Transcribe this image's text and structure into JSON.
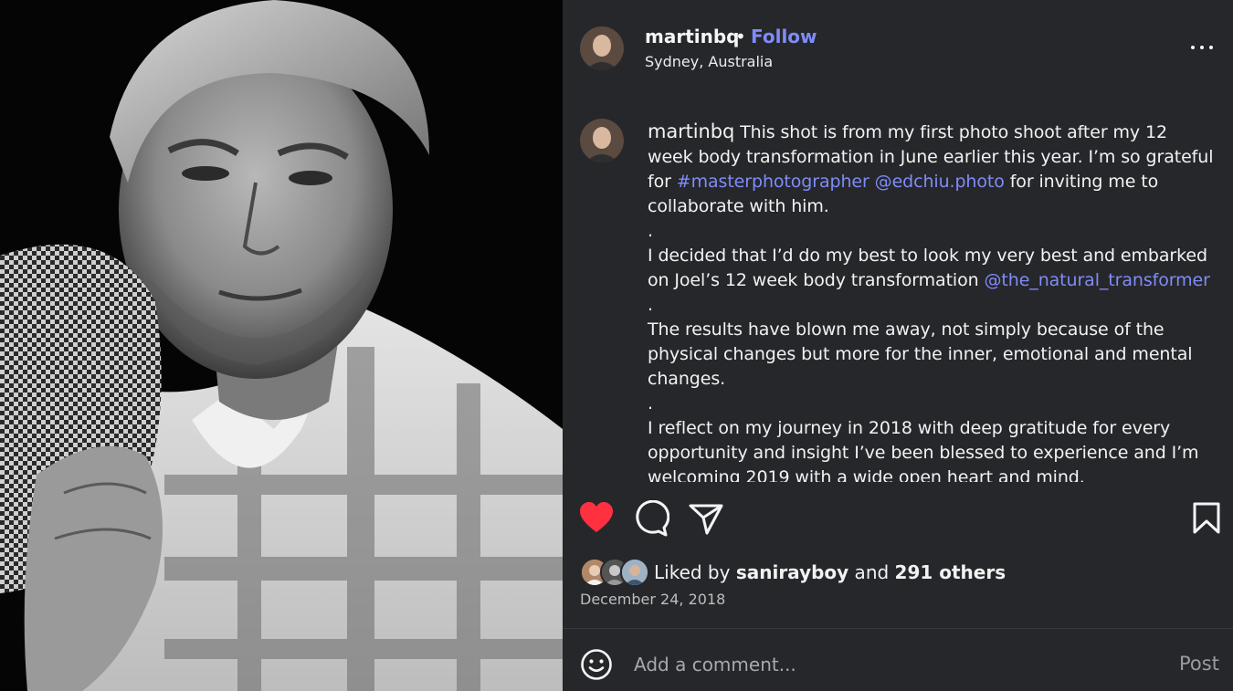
{
  "photo": {
    "icon": "portrait-photo",
    "description_icon": "black-and-white-man-portrait"
  },
  "header": {
    "username": "martinbq",
    "separator": "•",
    "follow_label": "Follow",
    "location": "Sydney, Australia",
    "more_icon": "more-horizontal-icon"
  },
  "caption": {
    "username": "martinbq",
    "p1_text1": " This shot is from my first photo shoot after my 12 week body transformation in June earlier this year. I’m so grateful for ",
    "p1_hashtag": "#masterphotographer",
    "p1_space": " ",
    "p1_mention": "@edchiu.photo",
    "p1_text2": " for inviting me to collaborate with him.",
    "dot1": ".",
    "p2_text": "I decided that I’d do my best to look my very best and embarked on Joel’s 12 week body transformation ",
    "p2_mention": "@the_natural_transformer",
    "dot2": ".",
    "p3_text": "The results have blown me away, not simply because of the physical changes but more for the inner, emotional and mental changes.",
    "dot3": ".",
    "p4_text": "I reflect on my journey in 2018 with deep gratitude for every opportunity and insight I’ve been blessed to experience and I’m welcoming 2019 with a wide open heart and mind."
  },
  "actions": {
    "like_icon": "heart-filled-icon",
    "comment_icon": "comment-icon",
    "share_icon": "send-icon",
    "save_icon": "bookmark-icon",
    "like_color": "#ff3040"
  },
  "likes": {
    "prefix": "Liked by ",
    "user": "sanirayboy",
    "middle": " and ",
    "others": "291 others"
  },
  "date": "December 24, 2018",
  "comment": {
    "emoji_icon": "smiley-icon",
    "placeholder": "Add a comment...",
    "post_label": "Post"
  },
  "colors": {
    "background": "#26272b",
    "link": "#7f8cf8",
    "text": "#f2f2f2",
    "muted": "#a9a9ad"
  }
}
